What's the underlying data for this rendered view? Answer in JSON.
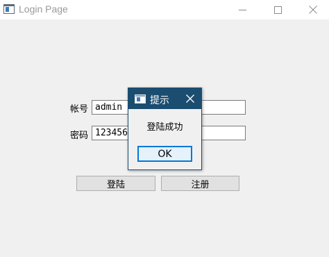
{
  "window": {
    "title": "Login Page",
    "controls": {
      "minimize_icon": "minimize-icon",
      "maximize_icon": "maximize-icon",
      "close_icon": "close-icon"
    }
  },
  "form": {
    "account_label": "帐号",
    "account_value": "admin",
    "password_label": "密码",
    "password_value": "123456",
    "login_button": "登陆",
    "register_button": "注册"
  },
  "dialog": {
    "title": "提示",
    "message": "登陆成功",
    "ok_button": "OK",
    "title_bar_color": "#1b4d70",
    "ok_focus_color": "#0078d7"
  }
}
